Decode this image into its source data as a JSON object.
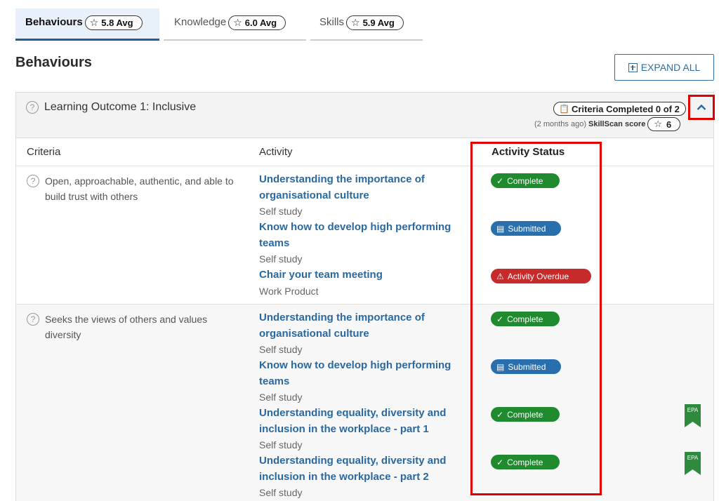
{
  "tabs": [
    {
      "label": "Behaviours",
      "avg": "5.8 Avg",
      "active": true
    },
    {
      "label": "Knowledge",
      "avg": "6.0 Avg",
      "active": false
    },
    {
      "label": "Skills",
      "avg": "5.9 Avg",
      "active": false
    }
  ],
  "page_title": "Behaviours",
  "expand_all": "EXPAND ALL",
  "outcome": {
    "title": "Learning Outcome 1: Inclusive",
    "criteria_completed": "Criteria Completed 0 of 2",
    "time_ago": "(2 months ago)",
    "skillscan_label": "SkillScan score",
    "skillscan_score": "6"
  },
  "columns": {
    "criteria": "Criteria",
    "activity": "Activity",
    "status": "Activity Status"
  },
  "rows": [
    {
      "criteria": "Open, approachable, authentic, and able to build trust with others",
      "activities": [
        {
          "title": "Understanding the importance of organisational culture",
          "type": "Self study",
          "status": "Complete"
        },
        {
          "title": "Know how to develop high performing teams",
          "type": "Self study",
          "status": "Submitted"
        },
        {
          "title": "Chair your team meeting",
          "type": "Work Product",
          "status": "Activity Overdue"
        }
      ]
    },
    {
      "criteria": "Seeks the views of others and values diversity",
      "activities": [
        {
          "title": "Understanding the importance of organisational culture",
          "type": "Self study",
          "status": "Complete"
        },
        {
          "title": "Know how to develop high performing teams",
          "type": "Self study",
          "status": "Submitted"
        },
        {
          "title": "Understanding equality, diversity and inclusion in the workplace - part 1",
          "type": "Self study",
          "status": "Complete",
          "epa": "EPA"
        },
        {
          "title": "Understanding equality, diversity and inclusion in the workplace - part 2",
          "type": "Self study",
          "status": "Complete",
          "epa": "EPA"
        }
      ]
    }
  ],
  "colors": {
    "accent": "#2a68a0",
    "complete": "#1f8a2e",
    "submitted": "#2a6fad",
    "overdue": "#c62a2a",
    "highlight": "#e10000",
    "epa": "#2e8a3c"
  }
}
